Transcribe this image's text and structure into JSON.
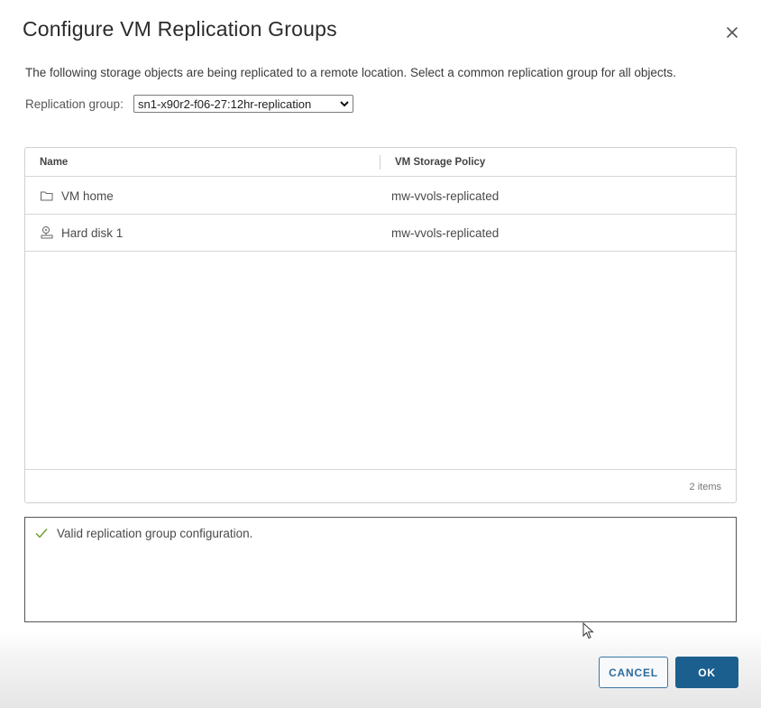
{
  "dialog": {
    "title": "Configure VM Replication Groups",
    "description": "The following storage objects are being replicated to a remote location. Select a common replication group for all objects.",
    "replication_group": {
      "label": "Replication group:",
      "selected": "sn1-x90r2-f06-27:12hr-replication"
    },
    "grid": {
      "columns": [
        "Name",
        "VM Storage Policy"
      ],
      "rows": [
        {
          "name": "VM home",
          "policy": "mw-vvols-replicated",
          "icon": "folder-icon"
        },
        {
          "name": "Hard disk 1",
          "policy": "mw-vvols-replicated",
          "icon": "hard-disk-icon"
        }
      ],
      "footer": "2 items"
    },
    "validation": {
      "message": "Valid replication group configuration.",
      "icon": "check-icon",
      "color": "#6a9a2c"
    },
    "buttons": {
      "cancel": "CANCEL",
      "ok": "OK"
    },
    "colors": {
      "primary": "#1b5f8f",
      "secondary_border": "#3a78a6"
    }
  }
}
